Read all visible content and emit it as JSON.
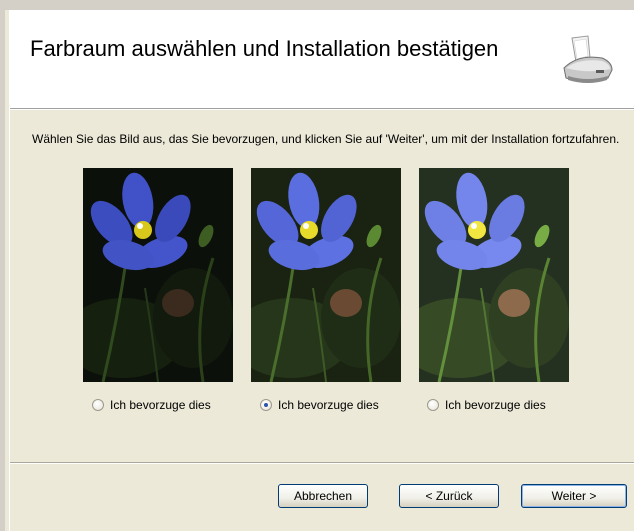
{
  "header": {
    "title": "Farbraum auswählen und Installation bestätigen",
    "icon": "scanner-icon"
  },
  "instruction": "Wählen Sie das Bild aus, das Sie bevorzugen, und klicken Sie auf 'Weiter', um mit der Installation fortzufahren.",
  "options": [
    {
      "label": "Ich bevorzuge dies",
      "checked": false,
      "brightness": "dark"
    },
    {
      "label": "Ich bevorzuge dies",
      "checked": true,
      "brightness": "medium"
    },
    {
      "label": "Ich bevorzuge dies",
      "checked": false,
      "brightness": "bright"
    }
  ],
  "buttons": {
    "cancel": "Abbrechen",
    "back": "< Zurück",
    "next": "Weiter >"
  }
}
